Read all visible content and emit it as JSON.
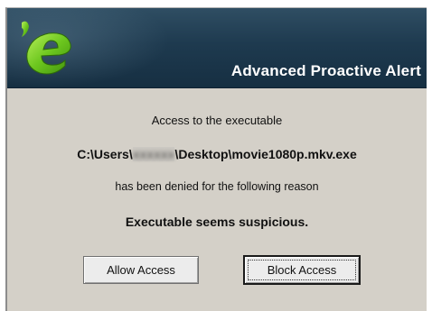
{
  "header": {
    "title": "Advanced Proactive Alert",
    "logo_icon": "emsisoft-e-logo",
    "colors": {
      "background": "#1e3a4f",
      "logo_green": "#7ed321"
    }
  },
  "message": {
    "line1": "Access to the executable",
    "path_prefix": "C:\\Users\\",
    "path_redacted": "xxxxxx",
    "path_suffix": "\\Desktop\\movie1080p.mkv.exe",
    "line2": "has been denied for the following reason",
    "reason": "Executable seems suspicious."
  },
  "buttons": {
    "allow_label": "Allow Access",
    "block_label": "Block Access"
  }
}
